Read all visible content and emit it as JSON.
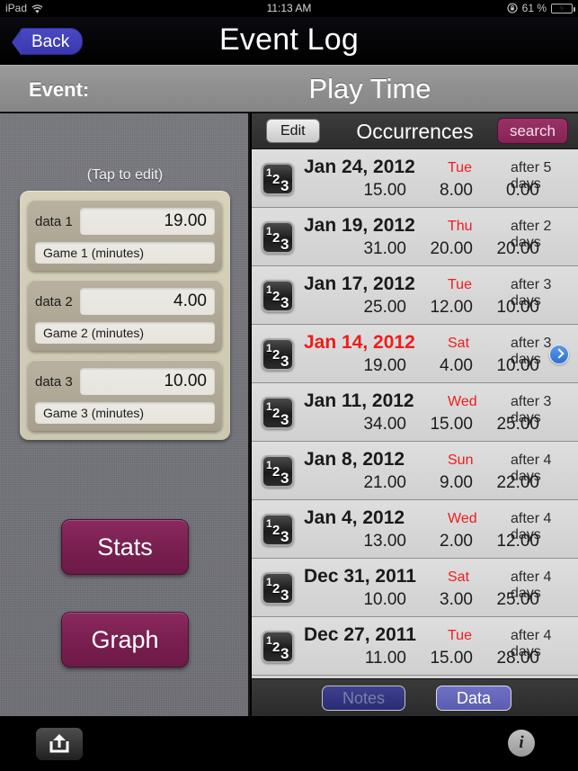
{
  "statusbar": {
    "device": "iPad",
    "wifi_icon": "wifi-icon",
    "time": "11:13 AM",
    "rotation_lock_icon": "rotation-lock-icon",
    "battery_percent": "61 %",
    "battery_icon": "battery-charging-icon"
  },
  "navbar": {
    "back_label": "Back",
    "title": "Event Log"
  },
  "eventbar": {
    "label": "Event:",
    "value": "Play Time"
  },
  "left": {
    "tap_hint": "(Tap to edit)",
    "fields": [
      {
        "label": "data 1",
        "value": "19.00",
        "name": "Game 1 (minutes)"
      },
      {
        "label": "data 2",
        "value": "4.00",
        "name": "Game 2 (minutes)"
      },
      {
        "label": "data 3",
        "value": "10.00",
        "name": "Game 3 (minutes)"
      }
    ],
    "stats_label": "Stats",
    "graph_label": "Graph"
  },
  "list": {
    "edit_label": "Edit",
    "title": "Occurrences",
    "search_label": "search",
    "row_icon": "numbers-123-icon",
    "disclosure_icon": "chevron-right-icon",
    "rows": [
      {
        "date": "Jan 24, 2012",
        "dow": "Tue",
        "after": "after 5 days",
        "v1": "15.00",
        "v2": "8.00",
        "v3": "0.00",
        "selected": false
      },
      {
        "date": "Jan 19, 2012",
        "dow": "Thu",
        "after": "after 2 days",
        "v1": "31.00",
        "v2": "20.00",
        "v3": "20.00",
        "selected": false
      },
      {
        "date": "Jan 17, 2012",
        "dow": "Tue",
        "after": "after 3 days",
        "v1": "25.00",
        "v2": "12.00",
        "v3": "10.00",
        "selected": false
      },
      {
        "date": "Jan 14, 2012",
        "dow": "Sat",
        "after": "after 3 days",
        "v1": "19.00",
        "v2": "4.00",
        "v3": "10.00",
        "selected": true
      },
      {
        "date": "Jan 11, 2012",
        "dow": "Wed",
        "after": "after 3 days",
        "v1": "34.00",
        "v2": "15.00",
        "v3": "25.00",
        "selected": false
      },
      {
        "date": "Jan 8, 2012",
        "dow": "Sun",
        "after": "after 4 days",
        "v1": "21.00",
        "v2": "9.00",
        "v3": "22.00",
        "selected": false
      },
      {
        "date": "Jan 4, 2012",
        "dow": "Wed",
        "after": "after 4 days",
        "v1": "13.00",
        "v2": "2.00",
        "v3": "12.00",
        "selected": false
      },
      {
        "date": "Dec 31, 2011",
        "dow": "Sat",
        "after": "after 4 days",
        "v1": "10.00",
        "v2": "3.00",
        "v3": "25.00",
        "selected": false
      },
      {
        "date": "Dec 27, 2011",
        "dow": "Tue",
        "after": "after 4 days",
        "v1": "11.00",
        "v2": "15.00",
        "v3": "28.00",
        "selected": false
      }
    ],
    "notes_label": "Notes",
    "data_label": "Data"
  },
  "bottombar": {
    "share_icon": "share-export-icon",
    "info_icon": "info-icon",
    "info_glyph": "i"
  },
  "colors": {
    "accent_magenta": "#7a1f51",
    "accent_blue": "#4a49c4",
    "highlight_red": "#f01c1c"
  }
}
